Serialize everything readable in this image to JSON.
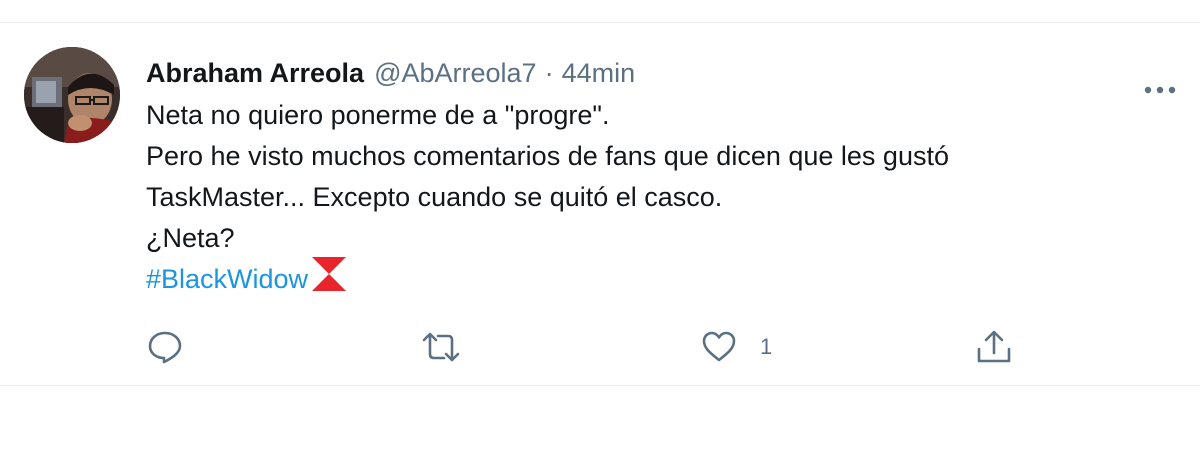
{
  "tweet": {
    "display_name": "Abraham Arreola",
    "handle": "@AbArreola7",
    "separator": "·",
    "time": "44min",
    "lines": [
      "Neta no quiero ponerme de a \"progre\".",
      "Pero he visto muchos comentarios de fans que dicen que les gustó",
      "TaskMaster... Excepto cuando se quitó el casco.",
      "¿Neta?"
    ],
    "hashtag": "#BlackWidow",
    "hashtag_emoji": "black-widow-hourglass-icon"
  },
  "actions": {
    "reply_count": "",
    "retweet_count": "",
    "like_count": "1",
    "share_count": ""
  },
  "colors": {
    "text": "#14171a",
    "secondary": "#5b7083",
    "link": "#1b95e0",
    "icon": "#5b7083",
    "emoji_red": "#e8242d",
    "border": "#ebeef0"
  },
  "icons": {
    "more": "more-horizontal-icon",
    "reply": "reply-bubble-icon",
    "retweet": "retweet-icon",
    "like": "heart-icon",
    "share": "share-upload-icon"
  }
}
